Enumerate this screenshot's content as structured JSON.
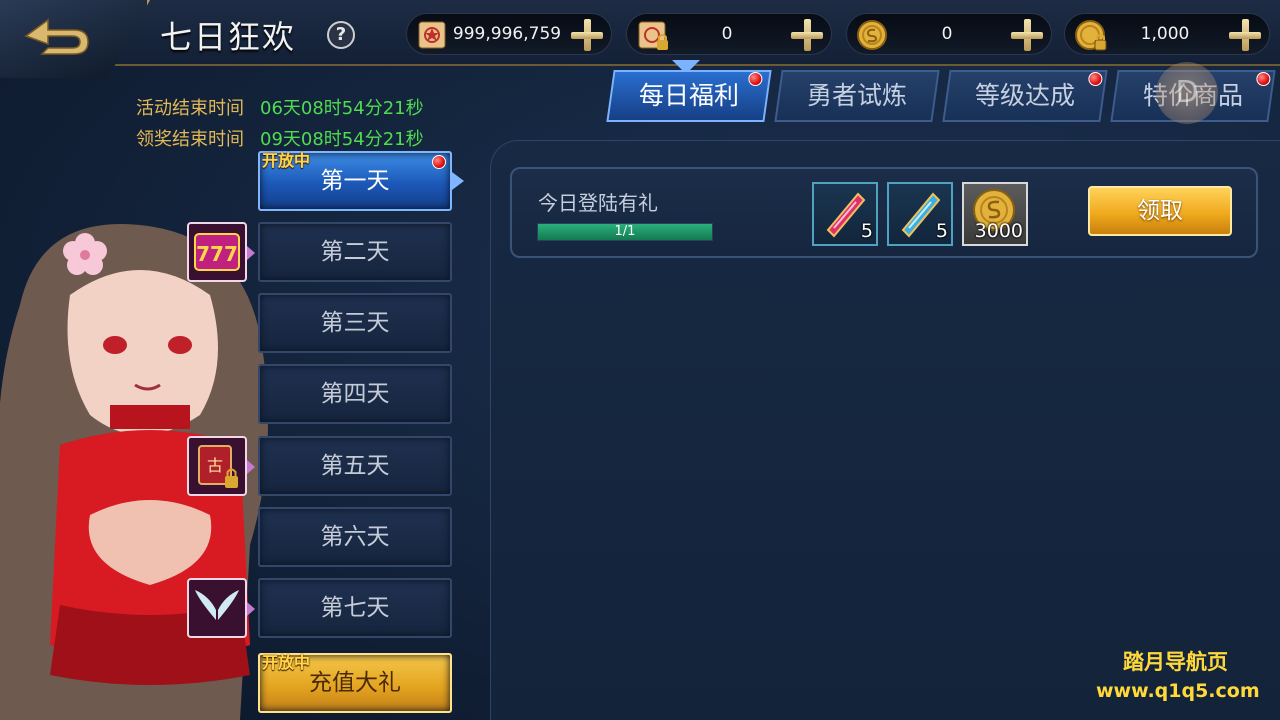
{
  "header": {
    "title": "七日狂欢",
    "help_label": "?"
  },
  "resources": [
    {
      "icon": "scroll-icon",
      "value": "999,996,759"
    },
    {
      "icon": "locked-scroll-icon",
      "value": "0"
    },
    {
      "icon": "gold-coin-icon",
      "value": "0"
    },
    {
      "icon": "locked-gold-coin-icon",
      "value": "1,000"
    }
  ],
  "timers": {
    "activity_end_label": "活动结束时间",
    "activity_end_value": "06天08时54分21秒",
    "claim_end_label": "领奖结束时间",
    "claim_end_value": "09天08时54分21秒"
  },
  "days": [
    {
      "label": "第一天",
      "status": "开放中",
      "active": true,
      "red_dot": true
    },
    {
      "label": "第二天"
    },
    {
      "label": "第三天"
    },
    {
      "label": "第四天"
    },
    {
      "label": "第五天"
    },
    {
      "label": "第六天"
    },
    {
      "label": "第七天"
    }
  ],
  "recharge": {
    "label": "充值大礼",
    "status": "开放中"
  },
  "side_icons": [
    "slot-777-icon",
    "locked-spellbook-icon",
    "angel-wings-icon"
  ],
  "tabs": [
    {
      "label": "每日福利",
      "active": true,
      "red_dot": true
    },
    {
      "label": "勇者试炼",
      "red_dot": false
    },
    {
      "label": "等级达成",
      "red_dot": true
    },
    {
      "label": "特价商品",
      "red_dot": true
    }
  ],
  "task": {
    "name": "今日登陆有礼",
    "progress_text": "1/1",
    "progress_fraction": 1.0,
    "rewards": [
      {
        "icon": "red-crystal-icon",
        "qty": "5"
      },
      {
        "icon": "blue-crystal-icon",
        "qty": "5"
      },
      {
        "icon": "gold-coin-icon",
        "qty": "3000"
      }
    ],
    "claim_label": "领取"
  },
  "watermark": {
    "title": "踏月导航页",
    "url": "www.q1q5.com"
  },
  "floating_badge": "D",
  "colors": {
    "accent_gold": "#f0aa1e",
    "active_blue": "#2a6fd0",
    "timer_label": "#e2b955",
    "timer_value": "#4fdc4f"
  }
}
